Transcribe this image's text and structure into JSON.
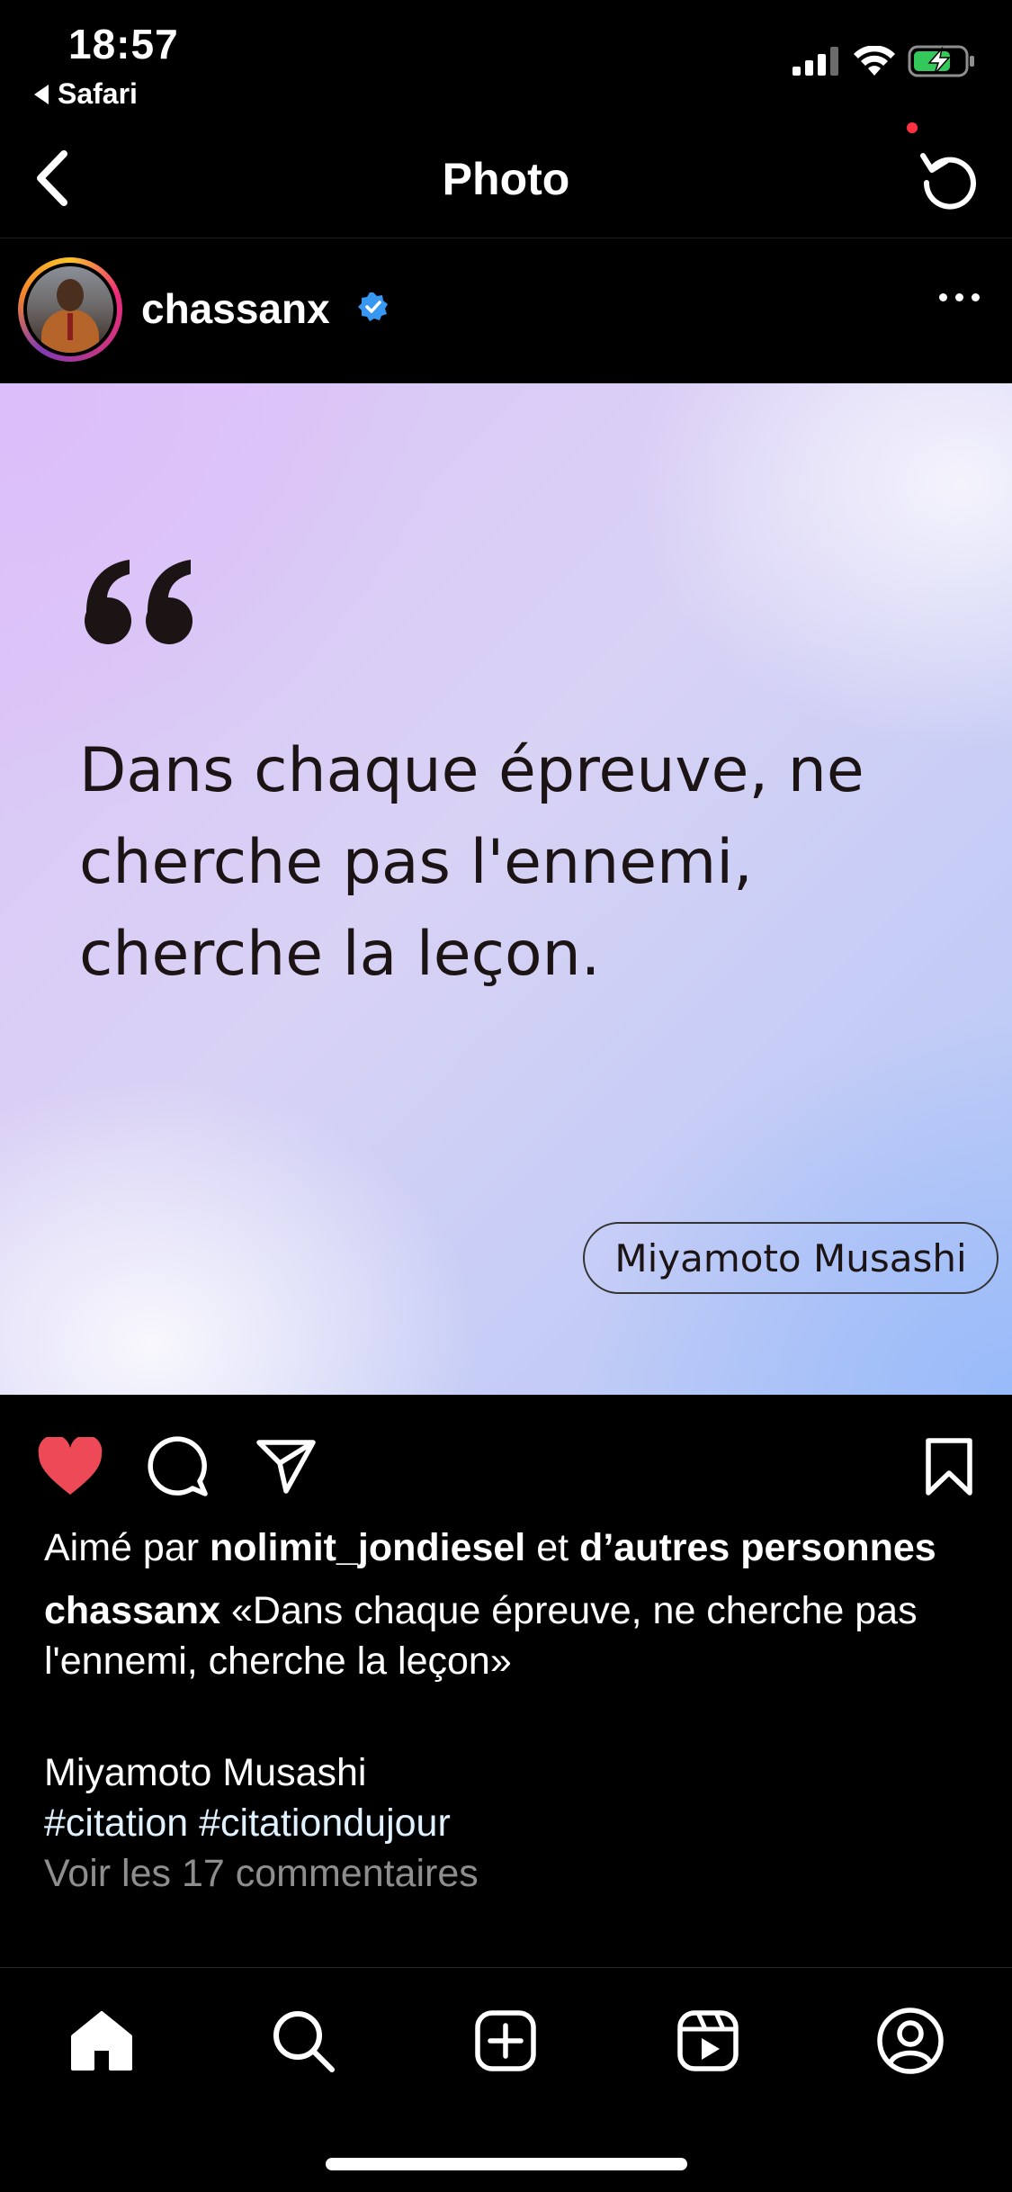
{
  "status_bar": {
    "time": "18:57",
    "back_app": "Safari"
  },
  "nav": {
    "title": "Photo"
  },
  "post": {
    "username": "chassanx",
    "verified": true,
    "quote_text": "Dans chaque épreuve, ne cherche pas l'ennemi, cherche la leçon.",
    "quote_author": "Miyamoto Musashi",
    "liked": true
  },
  "likes": {
    "prefix": "Aimé par",
    "user": "nolimit_jondiesel",
    "middle": "et",
    "suffix": "d’autres personnes"
  },
  "caption": {
    "username": "chassanx",
    "text": "«Dans chaque épreuve, ne cherche pas l'ennemi, cherche la leçon»",
    "author": "Miyamoto Musashi",
    "hashtags": "#citation #citationdujour",
    "comments_link": "Voir les 17 commentaires"
  },
  "tabs": [
    "home",
    "search",
    "create",
    "reels",
    "profile"
  ],
  "colors": {
    "like_red": "#ED4956",
    "verified_blue": "#3897F0",
    "notification_dot": "#FF3040"
  },
  "icons": {
    "back": "chevron-left-icon",
    "refresh": "refresh-icon",
    "more": "more-horizontal-icon",
    "like": "heart-icon",
    "comment": "comment-icon",
    "share": "paper-plane-icon",
    "save": "bookmark-icon"
  }
}
